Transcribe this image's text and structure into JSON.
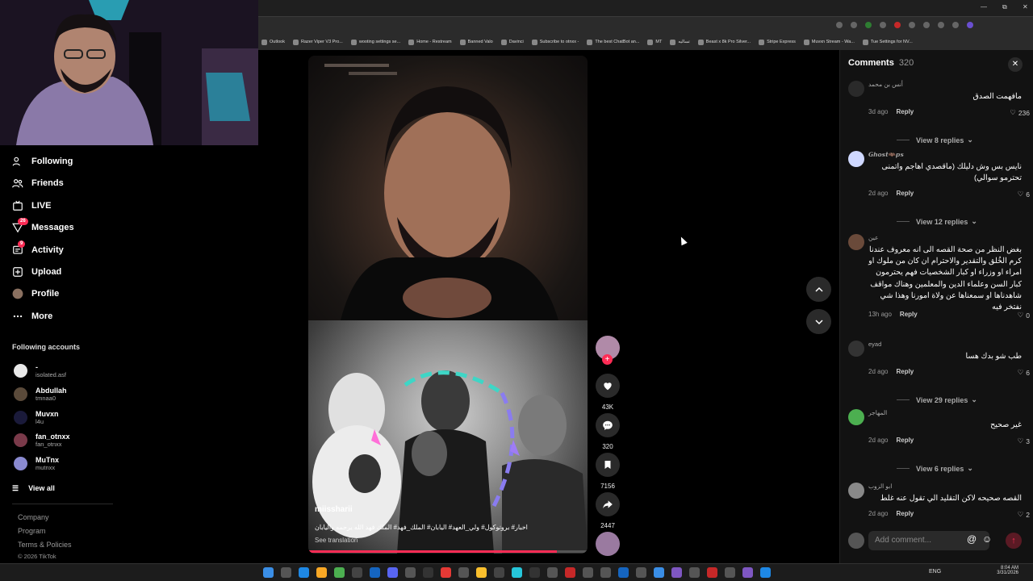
{
  "bookmarks": [
    "Outlook",
    "Razer Viper V3 Pro...",
    "wooting settings se...",
    "Home - Restream",
    "Banned Valo",
    "Davinci",
    "Subscribe to otnxx -",
    "The best ChatBot an...",
    "MT",
    "تساليه",
    "Beast x 8k Pro Silver...",
    "Stripe Express",
    "Muvxn Stream - Wa...",
    "Tue Settings for NV..."
  ],
  "sidebar": {
    "nav": [
      {
        "label": "Following",
        "icon": "following-icon",
        "badge": ""
      },
      {
        "label": "Friends",
        "icon": "friends-icon",
        "badge": ""
      },
      {
        "label": "LIVE",
        "icon": "live-icon",
        "badge": ""
      },
      {
        "label": "Messages",
        "icon": "messages-icon",
        "badge": "26"
      },
      {
        "label": "Activity",
        "icon": "activity-icon",
        "badge": "9"
      },
      {
        "label": "Upload",
        "icon": "upload-icon",
        "badge": ""
      },
      {
        "label": "Profile",
        "icon": "profile-icon",
        "badge": ""
      },
      {
        "label": "More",
        "icon": "more-icon",
        "badge": ""
      }
    ],
    "following_title": "Following accounts",
    "accounts": [
      {
        "name": "-",
        "handle": "isolated.asf"
      },
      {
        "name": "Abdullah",
        "handle": "tmnaa0"
      },
      {
        "name": "Muvxn",
        "handle": "l4u"
      },
      {
        "name": "fan_otnxx",
        "handle": "fan_otnxx"
      },
      {
        "name": "MuTnx",
        "handle": "mutnxx"
      }
    ],
    "view_all": "View all",
    "footer": [
      "Company",
      "Program",
      "Terms & Policies",
      "© 2026 TikTok"
    ]
  },
  "video": {
    "author": "miissharii",
    "caption": "اخبار# بروتوكول# ولي_العهد# اليابان# الملك_فهد# الملك فهد الله يرحمه واليابان",
    "see_translation": "See translation",
    "progress": 0.89
  },
  "actions": {
    "likes": "43K",
    "comments": "320",
    "saves": "7156",
    "shares": "2447"
  },
  "comments": {
    "title": "Comments",
    "count": "320",
    "items": [
      {
        "user": "أنس بن محمد",
        "text": "مافهمت الصدق",
        "age": "3d ago",
        "likes": "236",
        "replies": "View 8 replies"
      },
      {
        "user": "𝙂𝙝𝙤𝙨𝙩🦇𝙥𝙨",
        "text": "نايس بس وش دليلك (ماقصدي اهاجم واتمنى تحترمو سوالي)",
        "age": "2d ago",
        "likes": "6",
        "replies": "View 12 replies"
      },
      {
        "user": "عين",
        "text": "بغض النظر من صحة القصه الى انه معروف عندنا كرم الخُلق والتقدير والاحترام ان كان من ملوك او امراء او وزراء او كبار الشخصيات فهم يحترمون كبار السن وعلماء الدين والمعلمين وهناك مواقف شاهدناها او سمعناها عن ولاة امورنا وهذا شي نفتخر فيه",
        "age": "13h ago",
        "likes": "0",
        "replies": ""
      },
      {
        "user": "eyad",
        "text": "طب شو بدك هسا",
        "age": "2d ago",
        "likes": "6",
        "replies": "View 29 replies"
      },
      {
        "user": "المهاجر",
        "text": "غير صحيح",
        "age": "2d ago",
        "likes": "3",
        "replies": "View 6 replies"
      },
      {
        "user": "ابو الزوب",
        "text": "القصه صحيحه لاكن التقليد الي تقول عنه غلط",
        "age": "2d ago",
        "likes": "2",
        "replies": ""
      }
    ],
    "reply_label": "Reply",
    "add_placeholder": "Add comment..."
  },
  "taskbar": {
    "lang": "ENG",
    "time": "8:04 AM",
    "date": "3/31/2026"
  }
}
